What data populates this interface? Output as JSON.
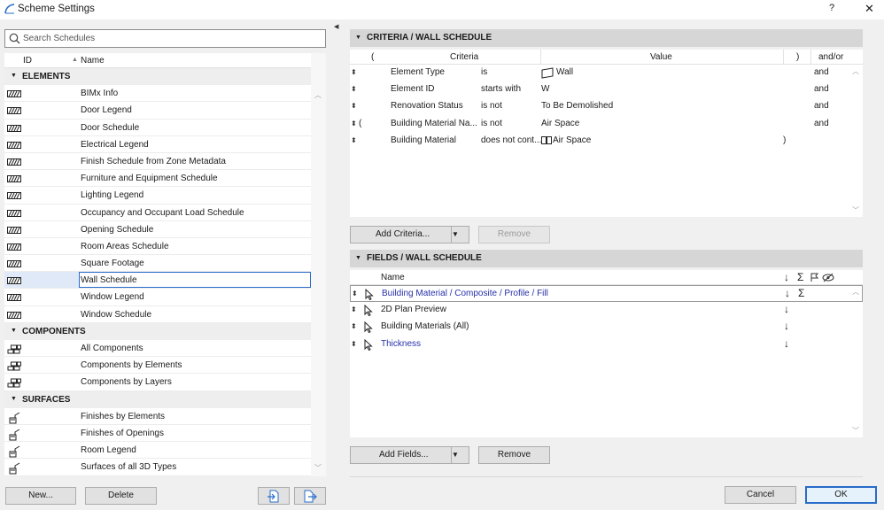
{
  "window": {
    "title": "Scheme Settings",
    "help_label": "?",
    "close_label": "✕"
  },
  "search": {
    "placeholder": "Search Schedules"
  },
  "list": {
    "header_id": "ID",
    "header_name": "Name",
    "groups": [
      {
        "label": "ELEMENTS",
        "icon": "hatch-icon",
        "items": [
          "BIMx Info",
          "Door Legend",
          "Door Schedule",
          "Electrical Legend",
          "Finish Schedule from Zone Metadata",
          "Furniture and Equipment Schedule",
          "Lighting Legend",
          "Occupancy and Occupant Load Schedule",
          "Opening Schedule",
          "Room Areas Schedule",
          "Square Footage",
          "Wall Schedule",
          "Window Legend",
          "Window Schedule"
        ]
      },
      {
        "label": "COMPONENTS",
        "icon": "brick-stack-icon",
        "items": [
          "All Components",
          "Components by Elements",
          "Components by Layers"
        ]
      },
      {
        "label": "SURFACES",
        "icon": "paint-brush-icon",
        "items": [
          "Finishes by Elements",
          "Finishes of Openings",
          "Room Legend",
          "Surfaces of all 3D Types"
        ]
      }
    ],
    "selected_item": "Wall Schedule"
  },
  "left_buttons": {
    "new_label": "New...",
    "delete_label": "Delete"
  },
  "criteria": {
    "section_title": "CRITERIA /  WALL SCHEDULE",
    "col_open": "(",
    "col_criteria": "Criteria",
    "col_value": "Value",
    "col_close": ")",
    "col_andor": "and/or",
    "rows": [
      {
        "open": "",
        "field": "Element Type",
        "op": "is",
        "value": "Wall",
        "value_icon": "wall-icon",
        "close": "",
        "andor": "and"
      },
      {
        "open": "",
        "field": "Element ID",
        "op": "starts with",
        "value": "W",
        "value_icon": "",
        "close": "",
        "andor": "and"
      },
      {
        "open": "",
        "field": "Renovation Status",
        "op": "is not",
        "value": "To Be Demolished",
        "value_icon": "",
        "close": "",
        "andor": "and"
      },
      {
        "open": "(",
        "field": "Building Material Na...",
        "op": "is not",
        "value": "Air Space",
        "value_icon": "",
        "close": "",
        "andor": "and"
      },
      {
        "open": "",
        "field": "Building Material",
        "op": "does not cont...",
        "value": "Air Space",
        "value_icon": "material-icon",
        "close": ")",
        "andor": ""
      }
    ],
    "add_label": "Add Criteria...",
    "remove_label": "Remove"
  },
  "fields": {
    "section_title": "FIELDS /  WALL SCHEDULE",
    "col_name": "Name",
    "col_sort": "↓",
    "col_sum": "Σ",
    "rows": [
      {
        "name": "Building Material / Composite / Profile / Fill",
        "linked": true,
        "sort": "↓",
        "sum": "Σ"
      },
      {
        "name": "2D Plan Preview",
        "linked": false,
        "sort": "↓",
        "sum": ""
      },
      {
        "name": "Building Materials (All)",
        "linked": false,
        "sort": "↓",
        "sum": ""
      },
      {
        "name": "Thickness",
        "linked": true,
        "sort": "↓",
        "sum": ""
      }
    ],
    "add_label": "Add Fields...",
    "remove_label": "Remove"
  },
  "dialog_buttons": {
    "cancel_label": "Cancel",
    "ok_label": "OK"
  },
  "colors": {
    "accent": "#2a6cc9",
    "link": "#2630a8",
    "section_header": "#d6d6d6"
  }
}
